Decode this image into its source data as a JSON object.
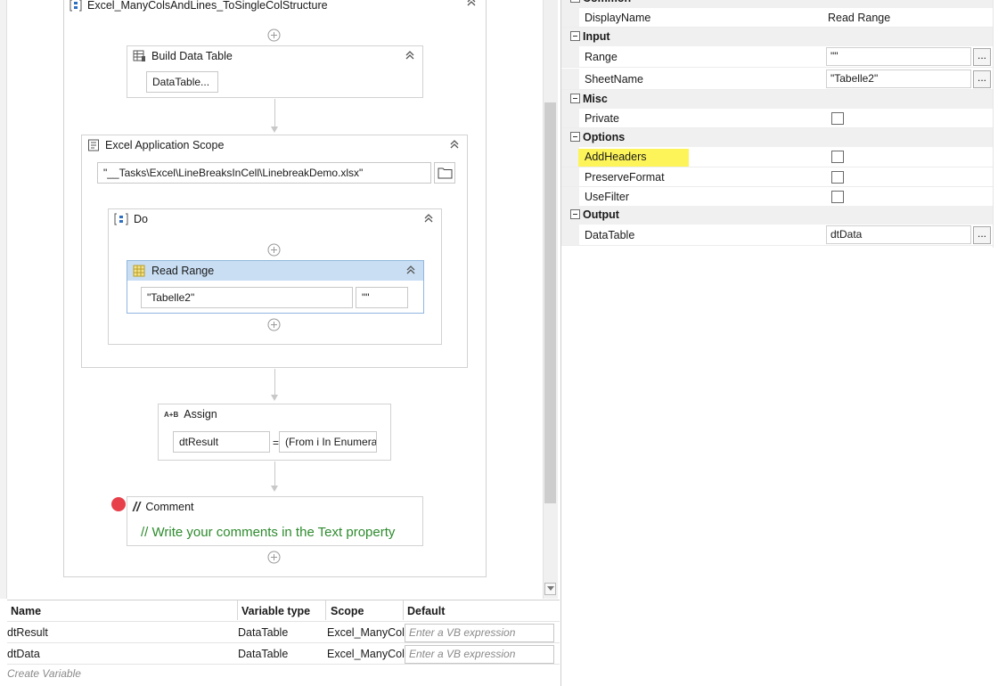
{
  "workflow": {
    "sequence_title": "Excel_ManyColsAndLines_ToSingleColStructure",
    "build_data_table": {
      "title": "Build Data Table",
      "button_label": "DataTable..."
    },
    "excel_scope": {
      "title": "Excel Application Scope",
      "path_value": "\"__Tasks\\Excel\\LineBreaksInCell\\LinebreakDemo.xlsx\""
    },
    "do_block": {
      "title": "Do"
    },
    "read_range": {
      "title": "Read Range",
      "sheet_value": "\"Tabelle2\"",
      "range_value": "\"\""
    },
    "assign": {
      "title": "Assign",
      "icon_text": "A+B",
      "target": "dtResult",
      "eq": "=",
      "value": "(From i In Enumera"
    },
    "comment": {
      "title": "Comment",
      "text": "// Write your comments in the Text property"
    }
  },
  "variables": {
    "headers": [
      "Name",
      "Variable type",
      "Scope",
      "Default"
    ],
    "rows": [
      {
        "name": "dtResult",
        "type": "DataTable",
        "scope": "Excel_ManyCols",
        "default_placeholder": "Enter a VB expression"
      },
      {
        "name": "dtData",
        "type": "DataTable",
        "scope": "Excel_ManyCols",
        "default_placeholder": "Enter a VB expression"
      }
    ],
    "create_label": "Create Variable"
  },
  "properties": {
    "categories": {
      "common": "Common",
      "input": "Input",
      "misc": "Misc",
      "options": "Options",
      "output": "Output"
    },
    "display_name": {
      "label": "DisplayName",
      "value": "Read Range"
    },
    "range": {
      "label": "Range",
      "value": "\"\""
    },
    "sheet_name": {
      "label": "SheetName",
      "value": "\"Tabelle2\""
    },
    "private": {
      "label": "Private"
    },
    "add_headers": {
      "label": "AddHeaders"
    },
    "preserve_format": {
      "label": "PreserveFormat"
    },
    "use_filter": {
      "label": "UseFilter"
    },
    "data_table": {
      "label": "DataTable",
      "value": "dtData"
    },
    "ellipsis": "..."
  },
  "colors": {
    "highlight": "#fdf45a",
    "selected_header": "#c9def3",
    "comment_green": "#2e8b2e",
    "breakpoint": "#e8404a"
  }
}
